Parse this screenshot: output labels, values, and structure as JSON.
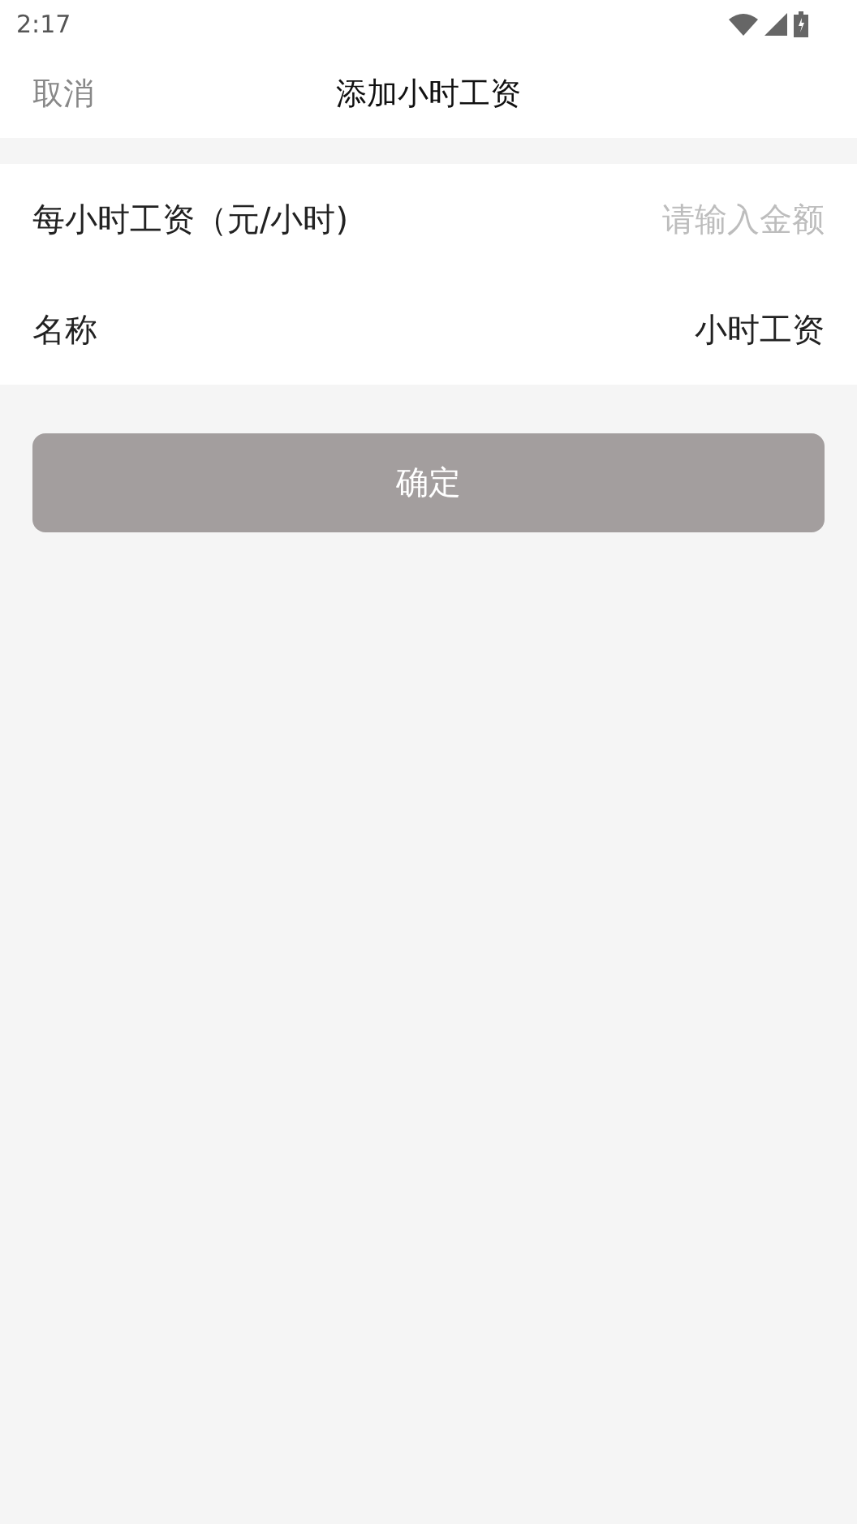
{
  "status_bar": {
    "time": "2:17"
  },
  "nav_bar": {
    "cancel": "取消",
    "title": "添加小时工资"
  },
  "form": {
    "fields": [
      {
        "kind": "input",
        "label": "每小时工资（元/小时)",
        "placeholder": "请输入金额"
      },
      {
        "kind": "value",
        "label": "名称",
        "value": "小时工资"
      }
    ]
  },
  "confirm_button": {
    "label": "确定",
    "disabled": true
  }
}
